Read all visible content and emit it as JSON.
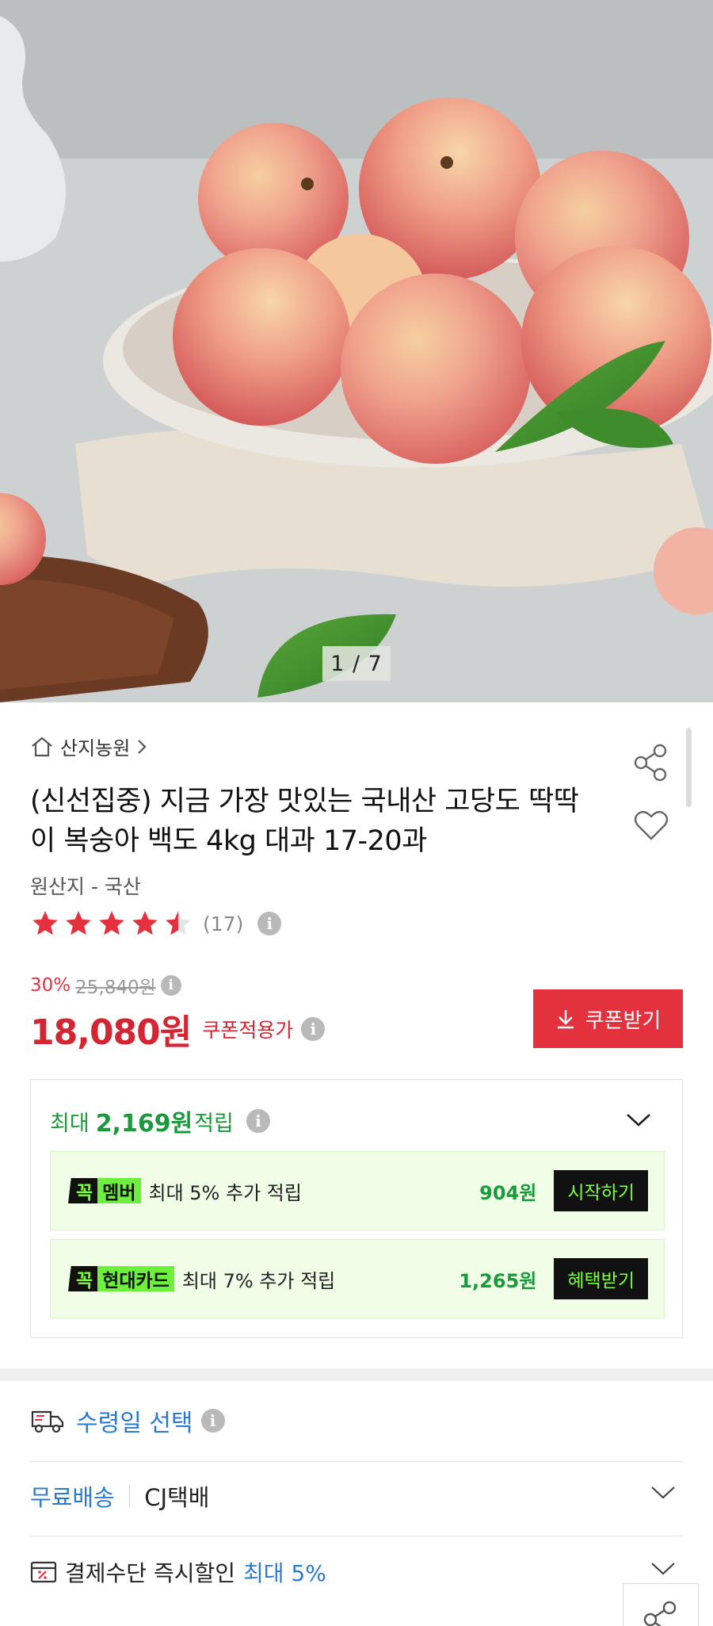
{
  "hero": {
    "page_counter": "1 / 7"
  },
  "store": {
    "name": "산지농원"
  },
  "product": {
    "title": "(신선집중) 지금 가장 맛있는 국내산 고당도 딱딱이 복숭아 백도 4kg 대과 17-20과",
    "origin": "원산지 - 국산",
    "rating": 4.5,
    "review_count": "(17)"
  },
  "price": {
    "discount_rate": "30%",
    "original": "25,840원",
    "sale": "18,080원",
    "coupon_applied_label": "쿠폰적용가",
    "coupon_button": "쿠폰받기"
  },
  "rewards": {
    "prefix": "최대",
    "amount": "2,169원",
    "suffix": "적립",
    "items": [
      {
        "badge_k": "꼭",
        "badge_name": "멤버",
        "text": "최대 5% 추가 적립",
        "amount": "904원",
        "button": "시작하기"
      },
      {
        "badge_k": "꼭",
        "badge_name": "현대카드",
        "text": "최대 7% 추가 적립",
        "amount": "1,265원",
        "button": "혜택받기"
      }
    ]
  },
  "delivery": {
    "date_label": "수령일 선택",
    "free_shipping": "무료배송",
    "carrier": "CJ택배",
    "payment_prefix": "결제수단 즉시할인",
    "payment_highlight": "최대 5%"
  },
  "colors": {
    "accent_red": "#e3323d",
    "price_red": "#d42532",
    "reward_green": "#1a9a3a",
    "link_blue": "#2a7ad1"
  },
  "icons": [
    "home-icon",
    "chevron-right-icon",
    "share-icon",
    "heart-icon",
    "star-icon",
    "info-icon",
    "download-icon",
    "chevron-down-icon",
    "truck-icon",
    "card-discount-icon"
  ]
}
